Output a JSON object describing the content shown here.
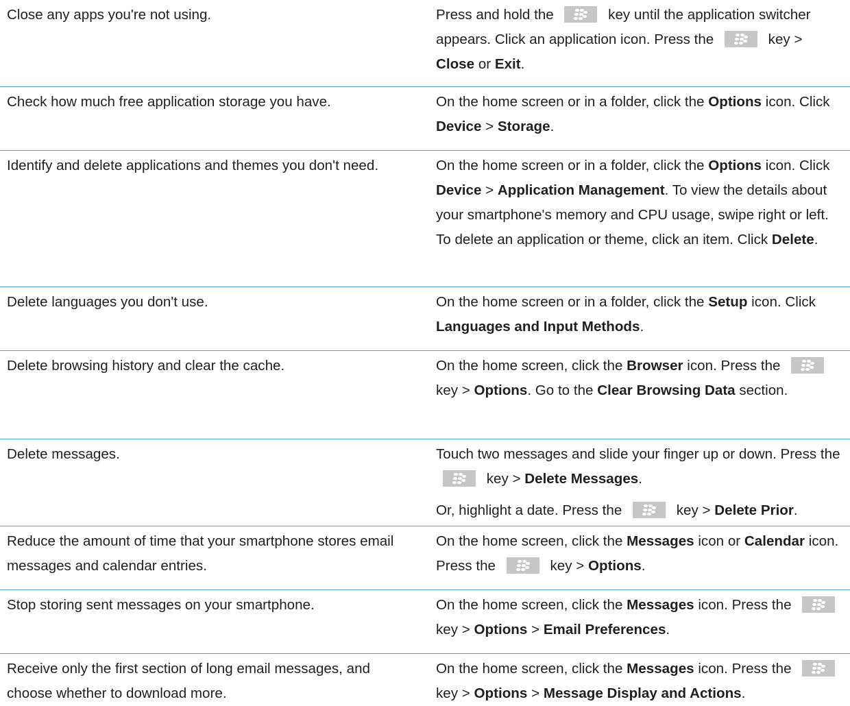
{
  "rows": [
    {
      "tip": "Close any apps you're not using.",
      "steps": [
        [
          {
            "t": "Press and hold the "
          },
          {
            "key": "blackberry-menu-key"
          },
          {
            "t": " key until the application switcher appears. Click an application icon. Press the "
          },
          {
            "key": "blackberry-menu-key"
          },
          {
            "t": " key > "
          },
          {
            "b": "Close"
          },
          {
            "t": " or "
          },
          {
            "b": "Exit"
          },
          {
            "t": "."
          }
        ]
      ]
    },
    {
      "tip": "Check how much free application storage you have.",
      "steps": [
        [
          {
            "t": "On the home screen or in a folder, click the "
          },
          {
            "b": "Options"
          },
          {
            "t": " icon. Click "
          },
          {
            "b": "Device"
          },
          {
            "t": " > "
          },
          {
            "b": "Storage"
          },
          {
            "t": "."
          }
        ]
      ]
    },
    {
      "tip": "Identify and delete applications and themes you don't need.",
      "steps": [
        [
          {
            "t": "On the home screen or in a folder, click the "
          },
          {
            "b": "Options"
          },
          {
            "t": " icon. Click "
          },
          {
            "b": "Device"
          },
          {
            "t": " > "
          },
          {
            "b": "Application Management"
          },
          {
            "t": ". To view the details about your smartphone's memory and CPU usage, swipe right or left. To delete an application or theme, click an item. Click "
          },
          {
            "b": "Delete"
          },
          {
            "t": "."
          }
        ]
      ]
    },
    {
      "tip": "Delete languages you don't use.",
      "steps": [
        [
          {
            "t": "On the home screen or in a folder, click the "
          },
          {
            "b": "Setup"
          },
          {
            "t": " icon. Click "
          },
          {
            "b": "Languages and Input Methods"
          },
          {
            "t": "."
          }
        ]
      ]
    },
    {
      "tip": "Delete browsing history and clear the cache.",
      "steps": [
        [
          {
            "t": "On the home screen, click the "
          },
          {
            "b": "Browser"
          },
          {
            "t": " icon. Press the "
          },
          {
            "key": "blackberry-menu-key"
          },
          {
            "t": " key > "
          },
          {
            "b": "Options"
          },
          {
            "t": ". Go to the "
          },
          {
            "b": "Clear Browsing Data"
          },
          {
            "t": " section."
          }
        ]
      ]
    },
    {
      "tip": "Delete messages.",
      "steps": [
        [
          {
            "t": "Touch two messages and slide your finger up or down. Press the "
          },
          {
            "key": "blackberry-menu-key"
          },
          {
            "t": " key > "
          },
          {
            "b": "Delete Messages"
          },
          {
            "t": "."
          }
        ],
        [
          {
            "t": "Or, highlight a date. Press the "
          },
          {
            "key": "blackberry-menu-key"
          },
          {
            "t": " key > "
          },
          {
            "b": "Delete Prior"
          },
          {
            "t": "."
          }
        ]
      ]
    },
    {
      "tip": "Reduce the amount of time that your smartphone stores email messages and calendar entries.",
      "steps": [
        [
          {
            "t": "On the home screen, click the "
          },
          {
            "b": "Messages"
          },
          {
            "t": " icon or "
          },
          {
            "b": "Calendar"
          },
          {
            "t": " icon. Press the "
          },
          {
            "key": "blackberry-menu-key"
          },
          {
            "t": " key > "
          },
          {
            "b": "Options"
          },
          {
            "t": "."
          }
        ]
      ]
    },
    {
      "tip": "Stop storing sent messages on your smartphone.",
      "steps": [
        [
          {
            "t": "On the home screen, click the "
          },
          {
            "b": "Messages"
          },
          {
            "t": " icon. Press the "
          },
          {
            "key": "blackberry-menu-key"
          },
          {
            "t": " key > "
          },
          {
            "b": "Options"
          },
          {
            "t": " > "
          },
          {
            "b": "Email Preferences"
          },
          {
            "t": "."
          }
        ]
      ]
    },
    {
      "tip": "Receive only the first section of long email messages, and choose whether to download more.",
      "steps": [
        [
          {
            "t": "On the home screen, click the "
          },
          {
            "b": "Messages"
          },
          {
            "t": " icon. Press the "
          },
          {
            "key": "blackberry-menu-key"
          },
          {
            "t": " key > "
          },
          {
            "b": "Options"
          },
          {
            "t": " > "
          },
          {
            "b": "Message Display and Actions"
          },
          {
            "t": "."
          }
        ]
      ]
    }
  ]
}
